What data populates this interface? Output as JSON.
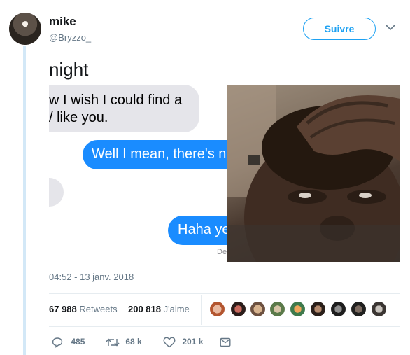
{
  "user": {
    "name": "mike",
    "handle": "@Bryzzo_",
    "follow_label": "Suivre"
  },
  "tweet": {
    "text": "night",
    "timestamp": "04:52 - 13 janv. 2018"
  },
  "screenshot_messages": {
    "received_1": "w I wish I could find a",
    "received_2": "/ like you.",
    "sent_1": "Well I mean, there's n",
    "sent_2": "Haha ye",
    "delivered": "De"
  },
  "stats": {
    "retweets_count": "67 988",
    "retweets_label": "Retweets",
    "likes_count": "200 818",
    "likes_label": "J'aime"
  },
  "actions": {
    "replies": "485",
    "retweets": "68 k",
    "likes": "201 k"
  },
  "colors": {
    "brand_blue": "#1da1f2",
    "imessage_blue": "#1a8cff",
    "muted": "#657786"
  },
  "icons": [
    "chevron-down-icon",
    "reply-icon",
    "retweet-icon",
    "heart-icon",
    "message-icon"
  ]
}
